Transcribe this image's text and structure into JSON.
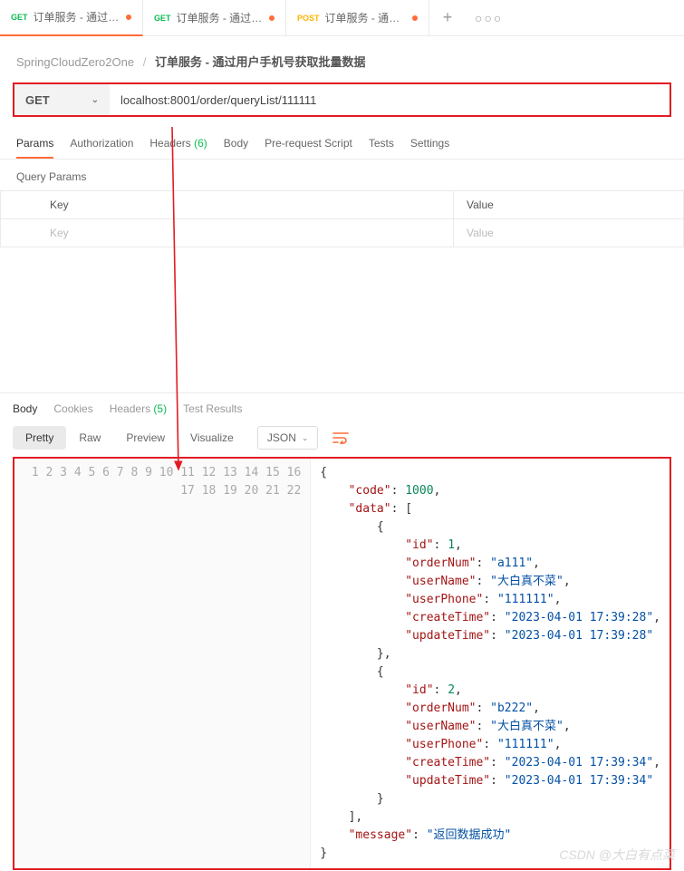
{
  "tabs": [
    {
      "method": "GET",
      "methodClass": "get",
      "title": "订单服务 - 通过用户手机号",
      "active": true,
      "dirty": true
    },
    {
      "method": "GET",
      "methodClass": "get",
      "title": "订单服务 - 通过订单号删除",
      "active": false,
      "dirty": true
    },
    {
      "method": "POST",
      "methodClass": "post",
      "title": "订单服务 - 通过订单号修改",
      "active": false,
      "dirty": true
    }
  ],
  "breadcrumb": {
    "collection": "SpringCloudZero2One",
    "request": "订单服务 - 通过用户手机号获取批量数据"
  },
  "request": {
    "method": "GET",
    "url": "localhost:8001/order/queryList/111111",
    "subtabs": [
      {
        "label": "Params",
        "active": true
      },
      {
        "label": "Authorization"
      },
      {
        "label": "Headers",
        "count": "(6)"
      },
      {
        "label": "Body"
      },
      {
        "label": "Pre-request Script"
      },
      {
        "label": "Tests"
      },
      {
        "label": "Settings"
      }
    ],
    "queryParamsLabel": "Query Params",
    "paramsHeader": {
      "key": "Key",
      "value": "Value"
    },
    "paramsPlaceholder": {
      "key": "Key",
      "value": "Value"
    }
  },
  "response": {
    "tabs": [
      {
        "label": "Body",
        "active": true
      },
      {
        "label": "Cookies"
      },
      {
        "label": "Headers",
        "count": "(5)"
      },
      {
        "label": "Test Results"
      }
    ],
    "views": [
      {
        "label": "Pretty",
        "active": true
      },
      {
        "label": "Raw"
      },
      {
        "label": "Preview"
      },
      {
        "label": "Visualize"
      }
    ],
    "format": "JSON",
    "body": {
      "code": 1000,
      "data": [
        {
          "id": 1,
          "orderNum": "a111",
          "userName": "大白真不菜",
          "userPhone": "111111",
          "createTime": "2023-04-01 17:39:28",
          "updateTime": "2023-04-01 17:39:28"
        },
        {
          "id": 2,
          "orderNum": "b222",
          "userName": "大白真不菜",
          "userPhone": "111111",
          "createTime": "2023-04-01 17:39:34",
          "updateTime": "2023-04-01 17:39:34"
        }
      ],
      "message": "返回数据成功"
    }
  },
  "watermark": "CSDN @大白有点菜"
}
